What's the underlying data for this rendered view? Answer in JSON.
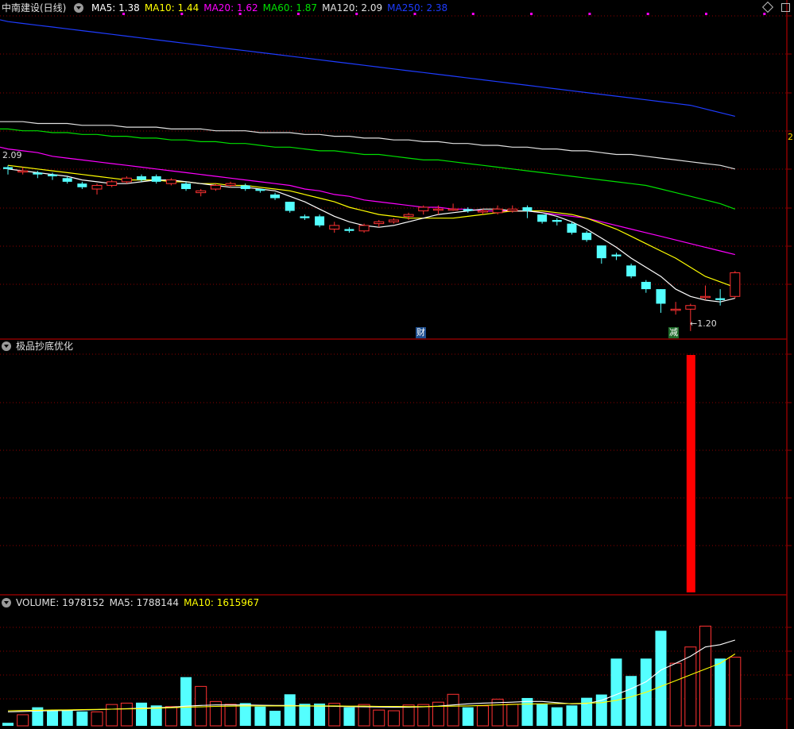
{
  "header": {
    "title": "中南建设(日线)",
    "ma_labels": [
      {
        "text": "MA5: 1.38",
        "color": "#ffffff"
      },
      {
        "text": "MA10: 1.44",
        "color": "#ffff00"
      },
      {
        "text": "MA20: 1.62",
        "color": "#ff00ff"
      },
      {
        "text": "MA60: 1.87",
        "color": "#00e000"
      },
      {
        "text": "MA120: 2.09",
        "color": "#e0e0e0"
      },
      {
        "text": "MA250: 2.38",
        "color": "#1e3cff"
      }
    ]
  },
  "price_panel": {
    "high_label": "2.09",
    "low_label": "←1.20",
    "marker_cai": "财",
    "marker_jian": "减",
    "right_edge_label": "2"
  },
  "indicator_panel": {
    "title": "极品抄底优化",
    "signal_color": "#ff0000"
  },
  "volume_panel": {
    "label_volume": "VOLUME: 1978152",
    "label_ma5": "MA5: 1788144",
    "label_ma10": "MA10: 1615967"
  },
  "colors": {
    "up": "#ff3232",
    "down": "#54ffff",
    "grid": "#8b0000",
    "ma5": "#ffffff",
    "ma10": "#ffff00",
    "ma20": "#ff00ff",
    "ma60": "#00e000",
    "ma120": "#e0e0e0",
    "ma250": "#1e3cff"
  },
  "chart_data": {
    "type": "candlestick",
    "series": [
      {
        "name": "K",
        "values": [
          [
            2.1,
            2.09,
            2.11,
            2.06
          ],
          [
            2.08,
            2.08,
            2.1,
            2.06
          ],
          [
            2.07,
            2.06,
            2.08,
            2.04
          ],
          [
            2.06,
            2.05,
            2.07,
            2.03
          ],
          [
            2.04,
            2.02,
            2.05,
            2.01
          ],
          [
            2.01,
            1.99,
            2.02,
            1.98
          ],
          [
            1.98,
            2.0,
            2.01,
            1.95
          ],
          [
            2.0,
            2.02,
            2.03,
            1.99
          ],
          [
            2.02,
            2.04,
            2.05,
            2.01
          ],
          [
            2.05,
            2.03,
            2.06,
            2.02
          ],
          [
            2.05,
            2.02,
            2.06,
            2.01
          ],
          [
            2.01,
            2.03,
            2.04,
            2.0
          ],
          [
            2.01,
            1.98,
            2.02,
            1.97
          ],
          [
            1.96,
            1.97,
            1.98,
            1.94
          ],
          [
            1.98,
            2.0,
            2.01,
            1.97
          ],
          [
            2.0,
            2.01,
            2.02,
            1.99
          ],
          [
            2.0,
            1.98,
            2.01,
            1.97
          ],
          [
            1.98,
            1.97,
            1.98,
            1.96
          ],
          [
            1.95,
            1.93,
            1.96,
            1.92
          ],
          [
            1.91,
            1.86,
            1.91,
            1.85
          ],
          [
            1.83,
            1.82,
            1.84,
            1.81
          ],
          [
            1.83,
            1.78,
            1.84,
            1.77
          ],
          [
            1.76,
            1.78,
            1.8,
            1.74
          ],
          [
            1.76,
            1.75,
            1.77,
            1.74
          ],
          [
            1.75,
            1.78,
            1.79,
            1.74
          ],
          [
            1.79,
            1.8,
            1.81,
            1.77
          ],
          [
            1.8,
            1.81,
            1.82,
            1.79
          ],
          [
            1.83,
            1.84,
            1.85,
            1.81
          ],
          [
            1.86,
            1.88,
            1.89,
            1.84
          ],
          [
            1.87,
            1.87,
            1.89,
            1.84
          ],
          [
            1.87,
            1.87,
            1.9,
            1.86
          ],
          [
            1.87,
            1.86,
            1.88,
            1.85
          ],
          [
            1.86,
            1.86,
            1.87,
            1.84
          ],
          [
            1.85,
            1.87,
            1.89,
            1.84
          ],
          [
            1.86,
            1.87,
            1.89,
            1.85
          ],
          [
            1.88,
            1.86,
            1.89,
            1.82
          ],
          [
            1.84,
            1.8,
            1.84,
            1.79
          ],
          [
            1.81,
            1.8,
            1.82,
            1.78
          ],
          [
            1.79,
            1.74,
            1.8,
            1.73
          ],
          [
            1.74,
            1.7,
            1.75,
            1.69
          ],
          [
            1.67,
            1.6,
            1.67,
            1.57
          ],
          [
            1.62,
            1.61,
            1.63,
            1.59
          ],
          [
            1.56,
            1.5,
            1.57,
            1.49
          ],
          [
            1.47,
            1.43,
            1.48,
            1.41
          ],
          [
            1.43,
            1.35,
            1.43,
            1.3
          ],
          [
            1.32,
            1.32,
            1.36,
            1.29
          ],
          [
            1.32,
            1.34,
            1.35,
            1.2
          ],
          [
            1.39,
            1.39,
            1.45,
            1.37
          ],
          [
            1.38,
            1.37,
            1.43,
            1.34
          ],
          [
            1.39,
            1.52,
            1.53,
            1.38
          ]
        ]
      }
    ],
    "ma5": [
      2.09,
      2.08,
      2.07,
      2.06,
      2.05,
      2.03,
      2.02,
      2.01,
      2.01,
      2.02,
      2.03,
      2.03,
      2.02,
      2.01,
      2.0,
      1.99,
      1.99,
      1.98,
      1.97,
      1.94,
      1.91,
      1.87,
      1.83,
      1.8,
      1.78,
      1.77,
      1.78,
      1.8,
      1.82,
      1.84,
      1.85,
      1.86,
      1.87,
      1.87,
      1.86,
      1.86,
      1.85,
      1.83,
      1.8,
      1.76,
      1.71,
      1.66,
      1.6,
      1.55,
      1.5,
      1.43,
      1.39,
      1.37,
      1.36,
      1.38
    ],
    "ma10": [
      2.11,
      2.1,
      2.09,
      2.08,
      2.07,
      2.06,
      2.05,
      2.04,
      2.03,
      2.03,
      2.03,
      2.02,
      2.02,
      2.01,
      2.01,
      2.0,
      2.0,
      1.99,
      1.98,
      1.97,
      1.95,
      1.93,
      1.91,
      1.88,
      1.86,
      1.84,
      1.83,
      1.82,
      1.82,
      1.82,
      1.82,
      1.83,
      1.84,
      1.85,
      1.86,
      1.86,
      1.86,
      1.85,
      1.84,
      1.82,
      1.79,
      1.76,
      1.72,
      1.68,
      1.64,
      1.6,
      1.55,
      1.5,
      1.47,
      1.44
    ],
    "ma20": [
      2.2,
      2.19,
      2.18,
      2.16,
      2.15,
      2.14,
      2.13,
      2.12,
      2.11,
      2.1,
      2.09,
      2.08,
      2.07,
      2.06,
      2.05,
      2.04,
      2.03,
      2.02,
      2.01,
      2.0,
      1.98,
      1.97,
      1.95,
      1.94,
      1.92,
      1.91,
      1.9,
      1.89,
      1.88,
      1.88,
      1.87,
      1.87,
      1.86,
      1.86,
      1.86,
      1.86,
      1.85,
      1.84,
      1.83,
      1.82,
      1.8,
      1.78,
      1.76,
      1.74,
      1.72,
      1.7,
      1.68,
      1.66,
      1.64,
      1.62
    ],
    "ma60": [
      2.31,
      2.3,
      2.3,
      2.29,
      2.29,
      2.28,
      2.28,
      2.27,
      2.27,
      2.26,
      2.26,
      2.25,
      2.25,
      2.24,
      2.24,
      2.23,
      2.23,
      2.22,
      2.21,
      2.21,
      2.2,
      2.19,
      2.19,
      2.18,
      2.17,
      2.17,
      2.16,
      2.15,
      2.14,
      2.14,
      2.13,
      2.12,
      2.11,
      2.1,
      2.09,
      2.08,
      2.07,
      2.06,
      2.05,
      2.04,
      2.03,
      2.02,
      2.01,
      2.0,
      1.98,
      1.96,
      1.94,
      1.92,
      1.9,
      1.87
    ],
    "ma120": [
      2.35,
      2.35,
      2.34,
      2.34,
      2.34,
      2.33,
      2.33,
      2.33,
      2.32,
      2.32,
      2.32,
      2.31,
      2.31,
      2.31,
      2.3,
      2.3,
      2.3,
      2.29,
      2.29,
      2.29,
      2.28,
      2.28,
      2.27,
      2.27,
      2.26,
      2.26,
      2.25,
      2.25,
      2.24,
      2.24,
      2.23,
      2.23,
      2.22,
      2.22,
      2.21,
      2.21,
      2.2,
      2.2,
      2.19,
      2.19,
      2.18,
      2.17,
      2.17,
      2.16,
      2.15,
      2.14,
      2.13,
      2.12,
      2.11,
      2.09
    ],
    "ma250": [
      2.9,
      2.89,
      2.88,
      2.87,
      2.86,
      2.85,
      2.84,
      2.83,
      2.82,
      2.81,
      2.8,
      2.79,
      2.78,
      2.77,
      2.76,
      2.75,
      2.74,
      2.73,
      2.72,
      2.71,
      2.7,
      2.69,
      2.68,
      2.67,
      2.66,
      2.65,
      2.64,
      2.63,
      2.62,
      2.61,
      2.6,
      2.59,
      2.58,
      2.57,
      2.56,
      2.55,
      2.54,
      2.53,
      2.52,
      2.51,
      2.5,
      2.49,
      2.48,
      2.47,
      2.46,
      2.45,
      2.44,
      2.42,
      2.4,
      2.38
    ],
    "volume": [
      130000,
      480000,
      800000,
      650000,
      700000,
      620000,
      600000,
      920000,
      980000,
      1000000,
      880000,
      830000,
      2100000,
      1700000,
      1050000,
      930000,
      980000,
      830000,
      650000,
      1360000,
      950000,
      960000,
      970000,
      800000,
      920000,
      680000,
      650000,
      900000,
      920000,
      1020000,
      1360000,
      800000,
      860000,
      1150000,
      930000,
      1200000,
      930000,
      800000,
      880000,
      1210000,
      1350000,
      2900000,
      2150000,
      2900000,
      4100000,
      2700000,
      3400000,
      4300000,
      2900000,
      2960000
    ],
    "vol_ma5": [
      600000,
      620000,
      640000,
      650000,
      660000,
      680000,
      700000,
      720000,
      740000,
      760000,
      780000,
      800000,
      850000,
      880000,
      900000,
      900000,
      900000,
      890000,
      880000,
      880000,
      860000,
      850000,
      840000,
      830000,
      820000,
      810000,
      800000,
      800000,
      820000,
      850000,
      900000,
      950000,
      980000,
      1000000,
      1020000,
      1050000,
      1050000,
      1000000,
      950000,
      960000,
      1100000,
      1350000,
      1600000,
      1900000,
      2400000,
      2700000,
      3000000,
      3400000,
      3500000,
      3700000
    ],
    "vol_ma10": [
      650000,
      660000,
      670000,
      680000,
      690000,
      700000,
      710000,
      720000,
      730000,
      740000,
      760000,
      780000,
      800000,
      820000,
      840000,
      850000,
      860000,
      860000,
      860000,
      860000,
      860000,
      860000,
      860000,
      850000,
      850000,
      840000,
      840000,
      830000,
      830000,
      840000,
      850000,
      860000,
      880000,
      900000,
      920000,
      940000,
      950000,
      960000,
      960000,
      980000,
      1000000,
      1100000,
      1250000,
      1450000,
      1700000,
      1950000,
      2200000,
      2450000,
      2700000,
      3100000
    ],
    "indicator_signal_index": 46,
    "ylim_price": [
      1.16,
      2.94
    ],
    "ylim_volume": [
      0,
      5000000
    ]
  }
}
